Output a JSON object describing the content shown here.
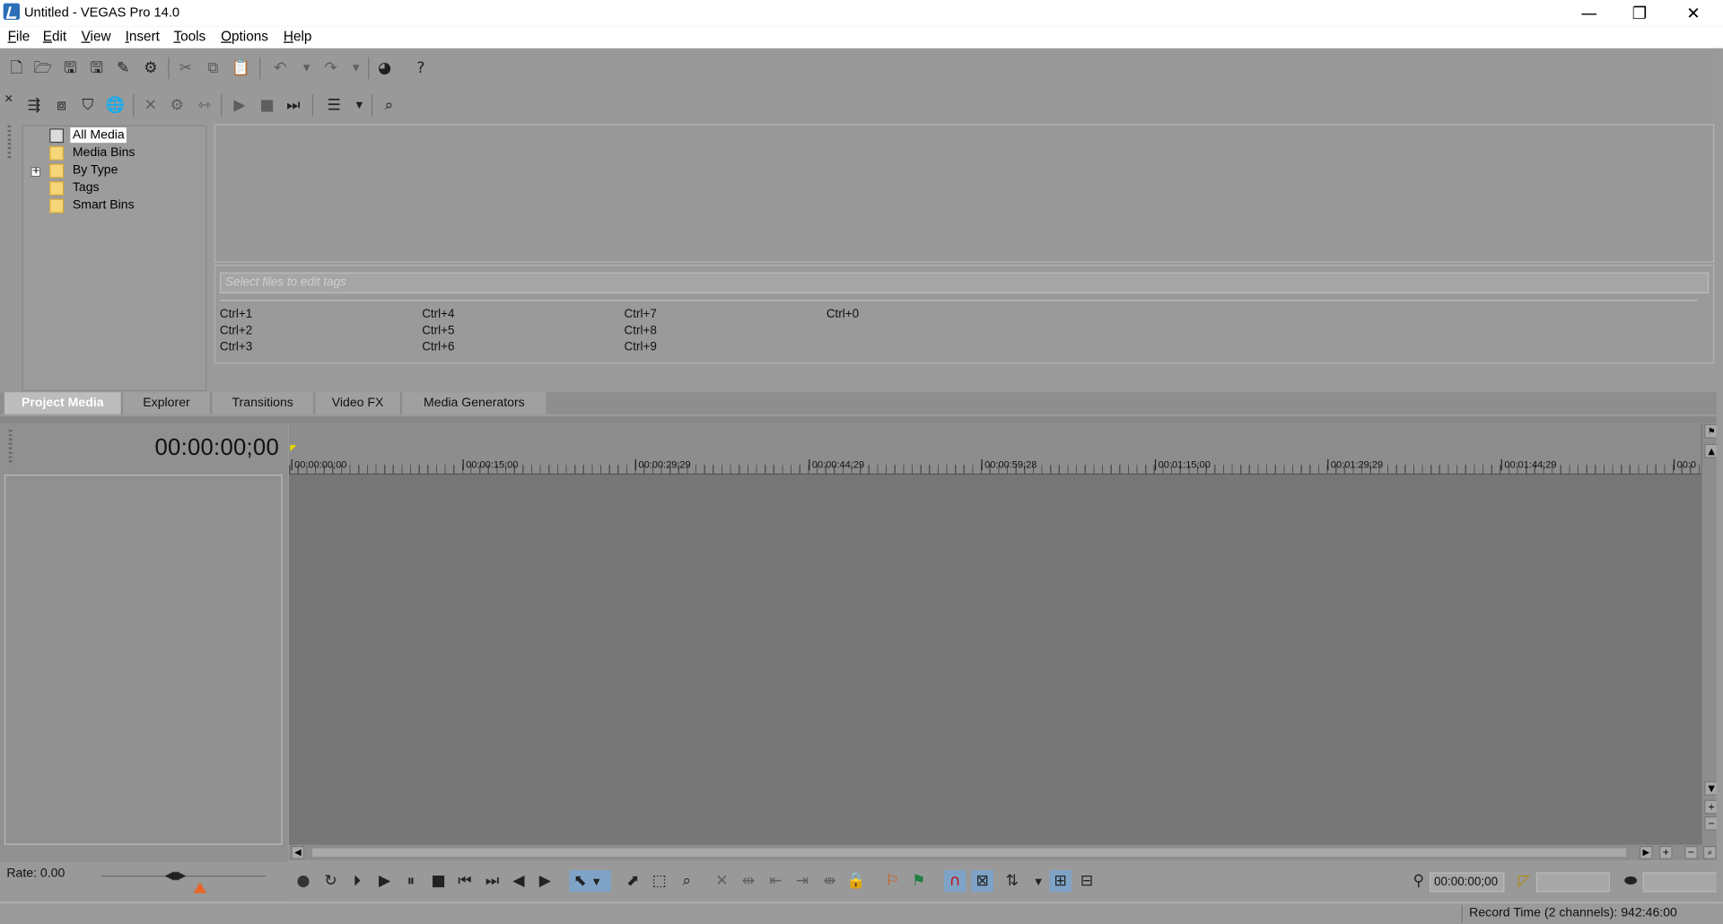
{
  "window": {
    "title": "Untitled - VEGAS Pro 14.0",
    "minimize": "—",
    "restore": "❐",
    "close": "✕"
  },
  "menu": [
    "File",
    "Edit",
    "View",
    "Insert",
    "Tools",
    "Options",
    "Help"
  ],
  "media_tree": [
    {
      "label": "All Media",
      "selected": true,
      "icon": "all-media-icon"
    },
    {
      "label": "Media Bins",
      "icon": "folder-icon"
    },
    {
      "label": "By Type",
      "icon": "folder-icon",
      "expandable": true
    },
    {
      "label": "Tags",
      "icon": "folder-icon"
    },
    {
      "label": "Smart Bins",
      "icon": "folder-icon"
    }
  ],
  "tags": {
    "placeholder": "Select files to edit tags",
    "shortcuts": [
      "Ctrl+1",
      "Ctrl+2",
      "Ctrl+3",
      "Ctrl+4",
      "Ctrl+5",
      "Ctrl+6",
      "Ctrl+7",
      "Ctrl+8",
      "Ctrl+9",
      "Ctrl+0"
    ]
  },
  "tabs": [
    "Project Media",
    "Explorer",
    "Transitions",
    "Video FX",
    "Media Generators"
  ],
  "active_tab": "Project Media",
  "timeline": {
    "timecode": "00:00:00;00",
    "ruler_labels": [
      "00:00:00;00",
      "00:00:15;00",
      "00:00:29;29",
      "00:00:44;29",
      "00:00:59;28",
      "00:01:15;00",
      "00:01:29;29",
      "00:01:44;29",
      "00:0"
    ]
  },
  "rate": {
    "label": "Rate: 0.00",
    "value": 0.0
  },
  "transport": {
    "cursor_position": "00:00:00;00",
    "selection_length": ""
  },
  "status": {
    "record_time": "Record Time (2 channels): 942:46:00"
  },
  "colors": {
    "background": "#9a9a9a",
    "timeline": "#777777",
    "active_tool": "#7fa3c7",
    "folder": "#f5d77a",
    "rate_marker": "#e8662a",
    "cursor_marker": "#e2d400"
  }
}
